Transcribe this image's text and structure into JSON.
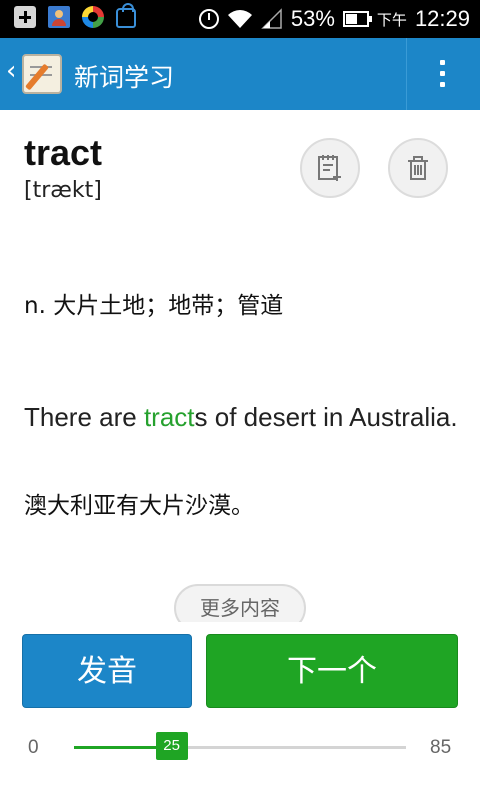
{
  "status_bar": {
    "battery_percent": "53%",
    "battery_level": 0.53,
    "time_prefix": "下午",
    "time": "12:29",
    "notification_icons": [
      "add-icon",
      "contact-card-icon",
      "sync-spinner-icon",
      "shopping-bag-icon"
    ],
    "system_icons": [
      "alarm-icon",
      "wifi-icon",
      "signal-icon",
      "battery-icon"
    ]
  },
  "app_bar": {
    "title": "新词学习",
    "back_icon": "chevron-left-icon",
    "menu_icon": "overflow-menu-icon",
    "color": "#1c86c8"
  },
  "word": {
    "text": "tract",
    "phonetic": "[trækt]",
    "add_to_notebook_icon": "notebook-add-icon",
    "delete_icon": "trash-icon"
  },
  "definition": "n. 大片土地；地带；管道",
  "example": {
    "before": "There are ",
    "highlight": "tract",
    "after": "s of desert in Australia.",
    "highlight_color": "#26a12e",
    "translation": "澳大利亚有大片沙漠。"
  },
  "more_button_label": "更多内容",
  "buttons": {
    "pronounce_label": "发音",
    "next_label": "下一个",
    "pronounce_color": "#1c86c8",
    "next_color": "#1fa524"
  },
  "progress": {
    "min": "0",
    "max": "85",
    "current": "25",
    "current_value": 25,
    "max_value": 85
  }
}
